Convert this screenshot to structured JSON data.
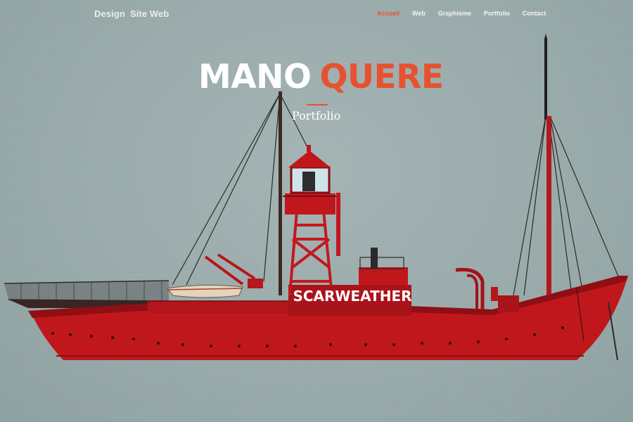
{
  "brand": {
    "part1": "Design",
    "part2": "Site Web"
  },
  "nav": {
    "items": [
      {
        "label": "Accueil",
        "active": true
      },
      {
        "label": "Web"
      },
      {
        "label": "Graphisme"
      },
      {
        "label": "Portfolio"
      },
      {
        "label": "Contact"
      }
    ]
  },
  "hero": {
    "title_first": "MANO",
    "title_second": "QUERE",
    "subtitle": "Portfolio",
    "ship_name": "SCARWEATHER"
  },
  "colors": {
    "accent": "#e8512f",
    "background": "#9eafaf",
    "hull": "#c0171d",
    "text": "#ffffff"
  }
}
